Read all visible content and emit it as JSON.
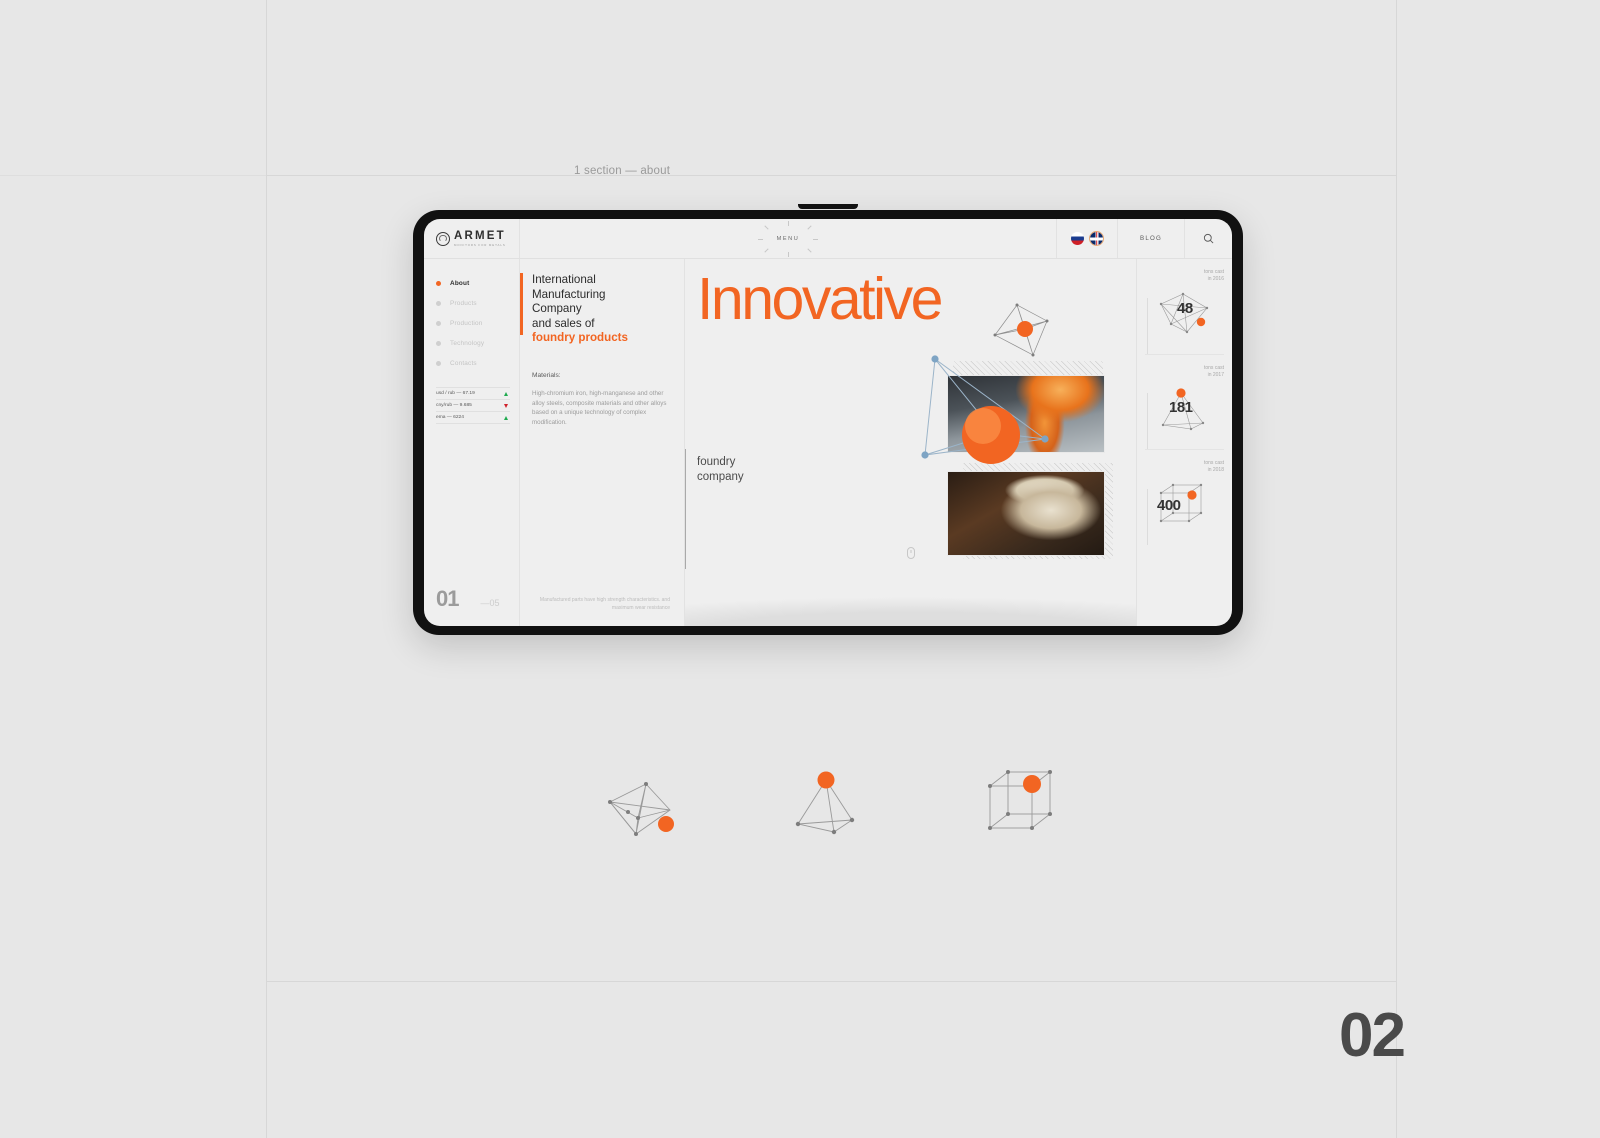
{
  "slide": {
    "label": "1 section — about",
    "page_number": "02"
  },
  "site": {
    "logo": {
      "name": "ARMET",
      "tagline": "MONITORS FOR METALS"
    },
    "header": {
      "menu_label": "MENU",
      "blog_label": "BLOG",
      "languages": [
        "ru",
        "en"
      ],
      "search_icon": "search-icon"
    },
    "nav": [
      {
        "label": "About",
        "active": true
      },
      {
        "label": "Products",
        "active": false
      },
      {
        "label": "Production",
        "active": false
      },
      {
        "label": "Technology",
        "active": false
      },
      {
        "label": "Contacts",
        "active": false
      }
    ],
    "rates": [
      {
        "text": "usd / rub — 67.19",
        "trend": "up"
      },
      {
        "text": "cny/rub — 9.685",
        "trend": "down"
      },
      {
        "text": "ema — 6224",
        "trend": "up"
      }
    ],
    "section_number": {
      "current": "01",
      "total": "—05"
    },
    "headline": {
      "line1": "International",
      "line2": "Manufacturing",
      "line3": "Company",
      "line4": "and sales of",
      "line5": "foundry products"
    },
    "materials": {
      "title": "Materials:",
      "body": "High-chromium iron, high-manganese and other alloy steels, composite materials and other alloys based on a unique technology of complex modification."
    },
    "mid_footer": "Manufactured parts have high strength characteristics. and maximum wear resistance",
    "hero": {
      "title": "Innovative",
      "subtitle_line1": "foundry",
      "subtitle_line2": "company",
      "scroll_icon": "mouse-scroll-icon"
    },
    "photos": [
      {
        "name": "molten-metal-pour-photo"
      },
      {
        "name": "foundry-worker-photo"
      }
    ],
    "stats": [
      {
        "caption_line1": "tons cast",
        "caption_line2": "in 2016",
        "value": "48",
        "shape": "polyhedron"
      },
      {
        "caption_line1": "tons cast",
        "caption_line2": "in 2017",
        "value": "181",
        "shape": "pyramid"
      },
      {
        "caption_line1": "tons cast",
        "caption_line2": "in 2018",
        "value": "400",
        "shape": "cube"
      }
    ]
  },
  "decorations": [
    {
      "name": "wireframe-polyhedron"
    },
    {
      "name": "wireframe-pyramid"
    },
    {
      "name": "wireframe-cube"
    }
  ],
  "colors": {
    "accent": "#f26522",
    "background": "#e7e7e7",
    "screen": "#efefef",
    "text_dark": "#2c2c2c",
    "text_muted": "#9c9c9c",
    "trend_up": "#1faa4e",
    "trend_down": "#d0212b"
  }
}
